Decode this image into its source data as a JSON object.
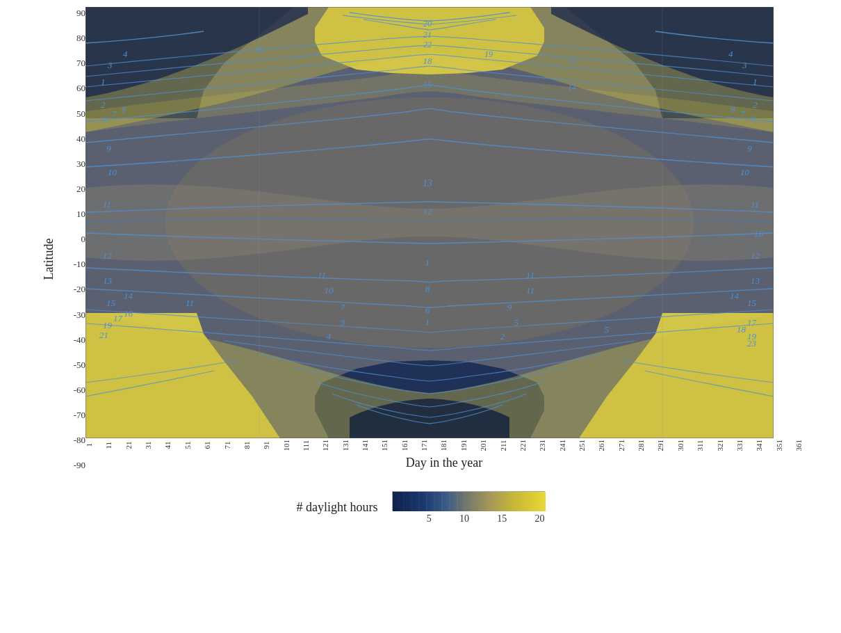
{
  "chart": {
    "title": "",
    "y_axis_label": "Latitude",
    "x_axis_label": "Day in the year",
    "y_ticks": [
      "90",
      "80",
      "70",
      "60",
      "50",
      "40",
      "30",
      "20",
      "10",
      "0",
      "-10",
      "-20",
      "-30",
      "-40",
      "-50",
      "-60",
      "-70",
      "-80",
      "-90"
    ],
    "x_ticks": [
      "1",
      "11",
      "21",
      "31",
      "41",
      "51",
      "61",
      "71",
      "81",
      "91",
      "101",
      "111",
      "121",
      "131",
      "141",
      "151",
      "161",
      "171",
      "181",
      "191",
      "201",
      "211",
      "221",
      "231",
      "241",
      "251",
      "261",
      "271",
      "281",
      "291",
      "301",
      "311",
      "321",
      "331",
      "341",
      "351",
      "361"
    ],
    "legend": {
      "title": "# daylight hours",
      "tick_labels": [
        "5",
        "10",
        "15",
        "20"
      ]
    }
  }
}
